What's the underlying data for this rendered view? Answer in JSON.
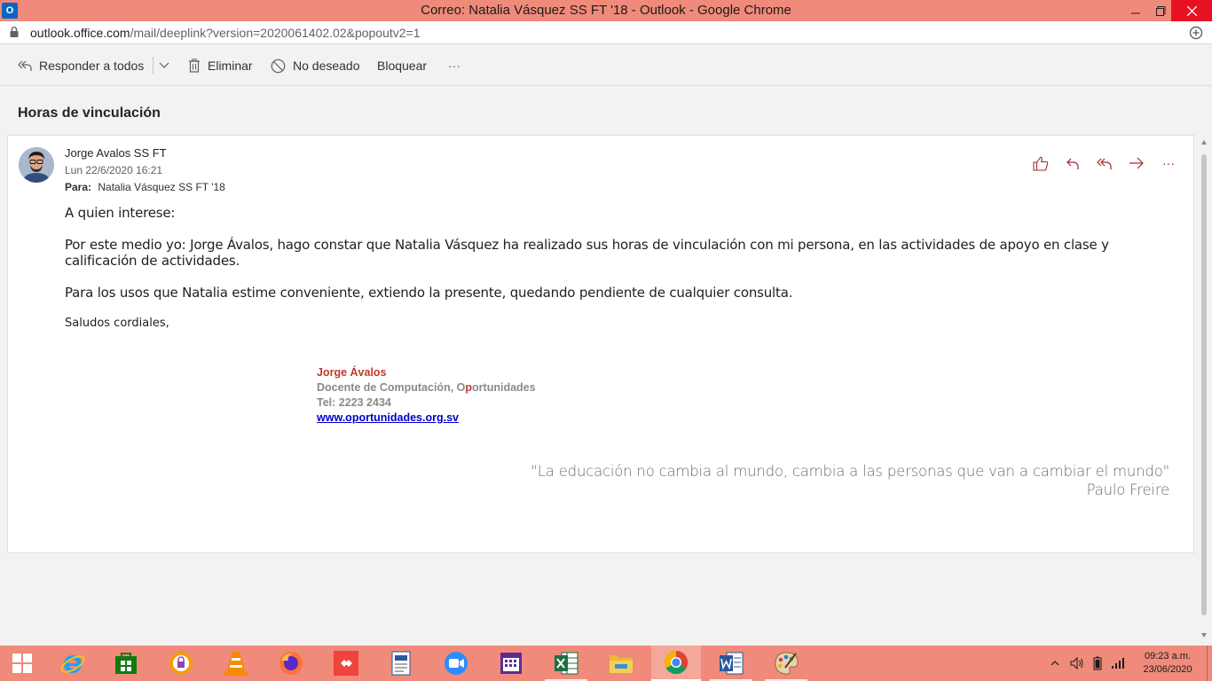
{
  "window": {
    "title": "Correo: Natalia Vásquez SS FT '18 - Outlook - Google Chrome",
    "app_icon_letter": "O",
    "minimize_icon": "minimize-icon",
    "maximize_icon": "maximize-icon",
    "close_icon": "close-icon"
  },
  "address": {
    "host": "outlook.office.com",
    "path": "/mail/deeplink?version=2020061402.02&popoutv2=1"
  },
  "toolbar": {
    "reply_all": "Responder a todos",
    "delete": "Eliminar",
    "junk": "No deseado",
    "block": "Bloquear",
    "more": "···"
  },
  "message": {
    "subject": "Horas de vinculación",
    "sender": "Jorge Avalos SS FT",
    "datetime": "Lun 22/6/2020 16:21",
    "to_label": "Para:",
    "to_value": "Natalia Vásquez SS FT '18",
    "more_actions": "···",
    "body": {
      "greeting": "A quien interese:",
      "para1_line1": "Por este medio yo: Jorge Ávalos, hago constar que Natalia Vásquez ha realizado sus horas de vinculación con mi persona, en las actividades de apoyo en clase y",
      "para1_line2": "calificación de actividades.",
      "para2": "Para los usos que Natalia estime conveniente, extiendo la presente, quedando pendiente de cualquier consulta.",
      "closing": "Saludos cordiales,"
    },
    "signature": {
      "name": "Jorge Ávalos",
      "role_prefix": "Docente de Computación, O",
      "role_red": "p",
      "role_suffix": "ortunidades",
      "tel": "Tel: 2223 2434",
      "link": "www.oportunidades.org.sv"
    },
    "quote": {
      "text": "\"La educación no cambia al mundo, cambia a las personas que van a cambiar el mundo\"",
      "author": "Paulo Freire"
    }
  },
  "taskbar": {
    "apps": [
      "start-icon",
      "ie-icon",
      "store-icon",
      "vpn-icon",
      "vlc-icon",
      "firefox-icon",
      "anydesk-icon",
      "editor-icon",
      "zoom-icon",
      "calendar-icon",
      "excel-icon",
      "explorer-icon",
      "chrome-icon",
      "word-icon",
      "paint-icon"
    ],
    "clock_time": "09:23 a.m.",
    "clock_date": "23/06/2020"
  },
  "colors": {
    "titlebar": "#f08a7a",
    "taskbar": "#f08a7a",
    "signature_red": "#c0392b",
    "link_blue": "#0000cc"
  }
}
